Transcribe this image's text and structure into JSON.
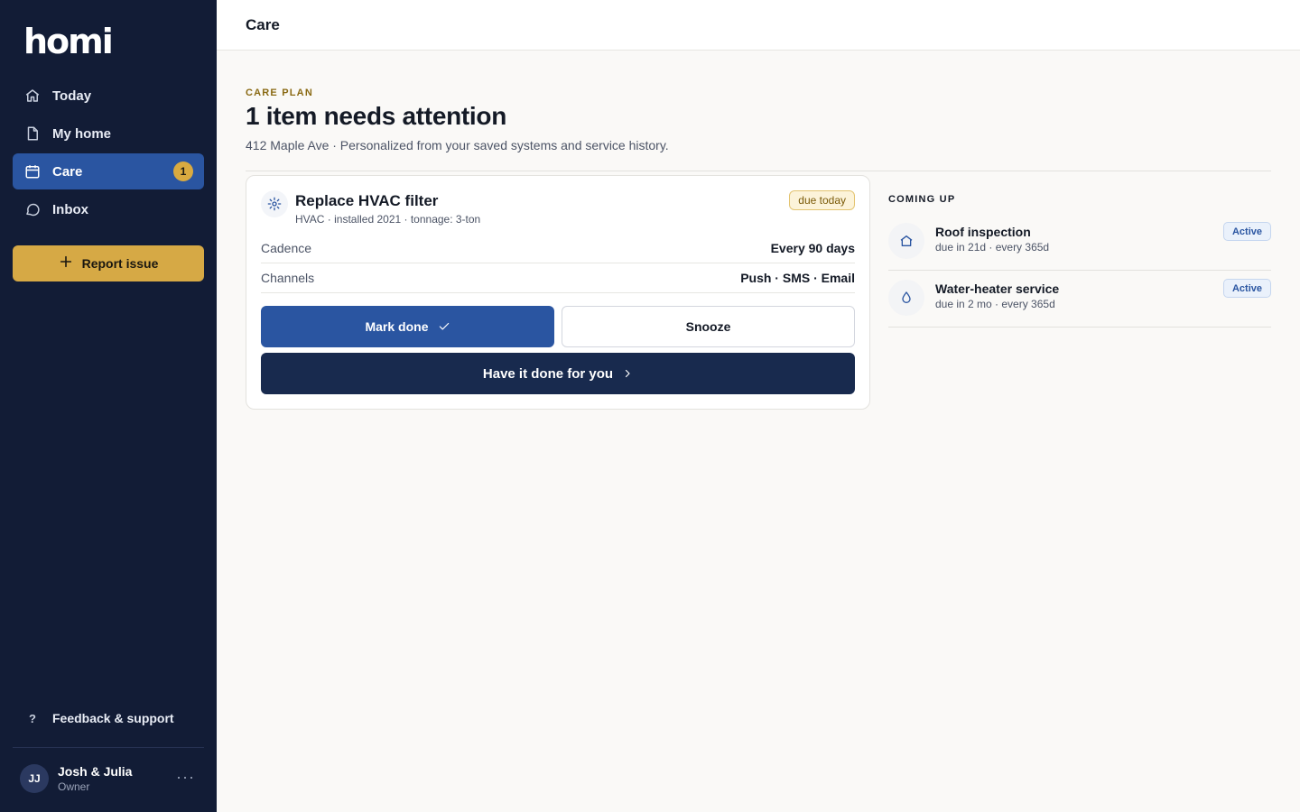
{
  "app": {
    "logo_text": "homi"
  },
  "sidebar": {
    "items": [
      {
        "label": "Today",
        "icon": "home-icon"
      },
      {
        "label": "My home",
        "icon": "document-icon"
      },
      {
        "label": "Care",
        "icon": "calendar-icon",
        "badge": "1",
        "active": true
      },
      {
        "label": "Inbox",
        "icon": "chat-bubble-icon"
      }
    ],
    "report_label": "Report issue",
    "feedback_label": "Feedback & support",
    "feedback_icon": "?",
    "user": {
      "initials": "JJ",
      "name": "Josh & Julia",
      "role": "Owner",
      "more": "···"
    }
  },
  "header": {
    "title": "Care"
  },
  "main": {
    "eyebrow": "CARE PLAN",
    "title": "1 item needs attention",
    "subtitle": "412 Maple Ave · Personalized from your saved systems and service history."
  },
  "task": {
    "title": "Replace HVAC filter",
    "meta": "HVAC · installed 2021 · tonnage: 3-ton",
    "due_badge": "due today",
    "rows": [
      {
        "label": "Cadence",
        "value": "Every 90 days"
      },
      {
        "label": "Channels",
        "value": "Push · SMS · Email"
      }
    ],
    "mark_done_label": "Mark done",
    "snooze_label": "Snooze",
    "pro_label": "Have it done for you"
  },
  "coming_up": {
    "title": "COMING UP",
    "items": [
      {
        "title": "Roof inspection",
        "sub": "due in 21d · every 365d",
        "status": "Active",
        "icon": "house-icon"
      },
      {
        "title": "Water-heater service",
        "sub": "due in 2 mo · every 365d",
        "status": "Active",
        "icon": "water-drop-icon"
      }
    ]
  },
  "colors": {
    "sidebar_bg": "#121c36",
    "accent": "#2a55a1",
    "gold": "#d6a945",
    "dark_button": "#182a4e"
  }
}
